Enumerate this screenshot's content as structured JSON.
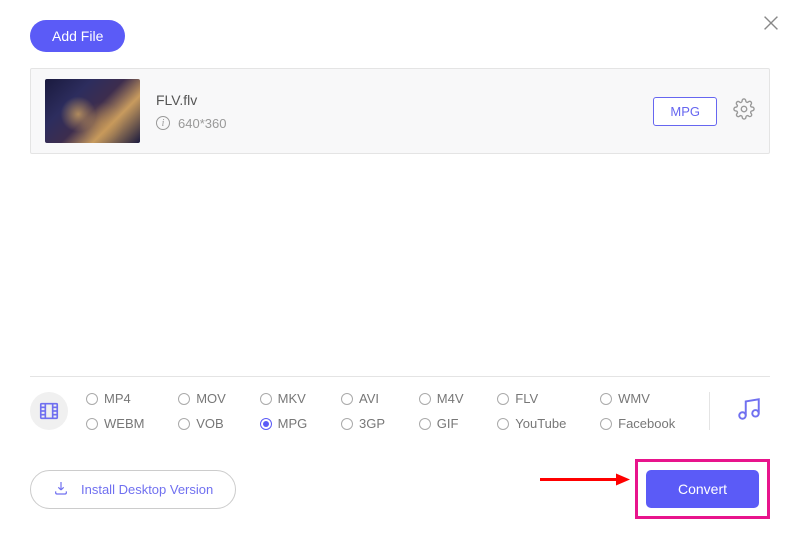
{
  "buttons": {
    "addFile": "Add File",
    "installDesktop": "Install Desktop Version",
    "convert": "Convert"
  },
  "file": {
    "name": "FLV.flv",
    "resolution": "640*360",
    "targetFormat": "MPG"
  },
  "formats": {
    "row1": [
      "MP4",
      "MOV",
      "MKV",
      "AVI",
      "M4V",
      "FLV",
      "WMV"
    ],
    "row2": [
      "WEBM",
      "VOB",
      "MPG",
      "3GP",
      "GIF",
      "YouTube",
      "Facebook"
    ],
    "selected": "MPG"
  }
}
